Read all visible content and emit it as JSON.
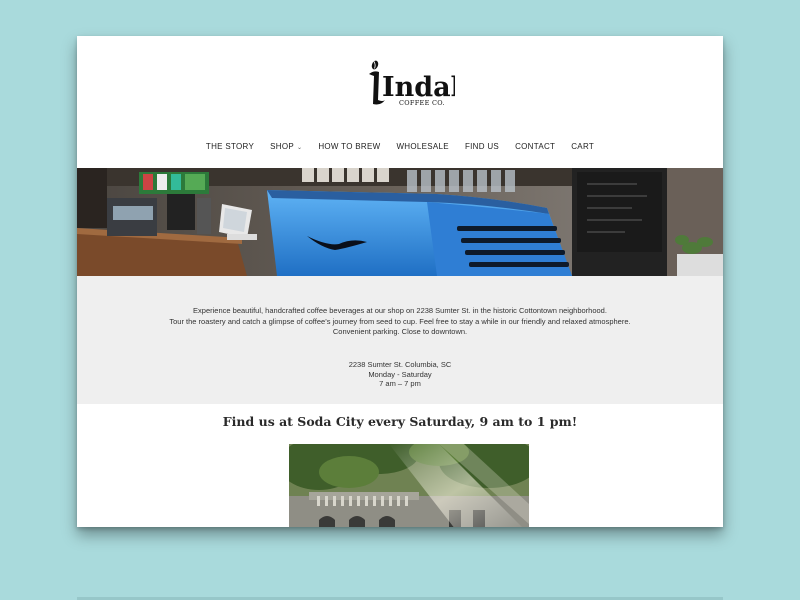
{
  "brand": {
    "logo_text": "Indah",
    "logo_subtext": "COFFEE CO."
  },
  "nav": {
    "items": [
      {
        "label": "THE STORY"
      },
      {
        "label": "SHOP",
        "has_dropdown": true
      },
      {
        "label": "HOW TO BREW"
      },
      {
        "label": "WHOLESALE"
      },
      {
        "label": "FIND US"
      },
      {
        "label": "CONTACT"
      },
      {
        "label": "CART"
      }
    ]
  },
  "info": {
    "line1": "Experience beautiful, handcrafted coffee beverages at our shop on 2238 Sumter St. in the historic Cottontown neighborhood.",
    "line2": "Tour the roastery and catch a glimpse of coffee’s journey from seed to cup. Feel free to stay a while in our friendly and relaxed atmosphere.",
    "line3": "Convenient parking. Close to downtown.",
    "address": "2238 Sumter St. Columbia, SC",
    "days": "Monday - Saturday",
    "hours": "7 am – 7 pm"
  },
  "soda_city": {
    "heading": "Find us at Soda City every Saturday, 9 am to 1 pm!"
  },
  "colors": {
    "background": "#a9dadc",
    "info_band": "#efefef",
    "espresso_machine": "#2f8fe0"
  }
}
